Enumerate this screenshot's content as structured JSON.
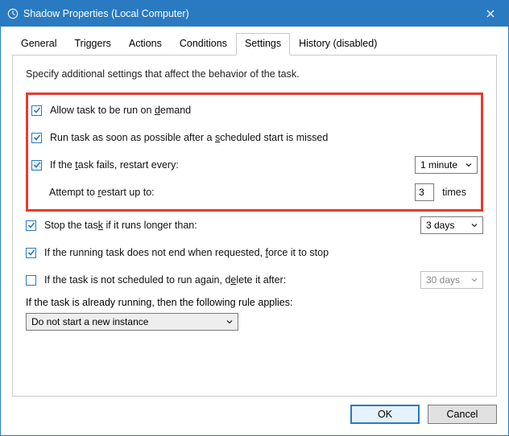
{
  "window": {
    "title": "Shadow Properties (Local Computer)"
  },
  "tabs": {
    "general": "General",
    "triggers": "Triggers",
    "actions": "Actions",
    "conditions": "Conditions",
    "settings": "Settings",
    "history": "History (disabled)"
  },
  "settings": {
    "description": "Specify additional settings that affect the behavior of the task.",
    "allow_on_demand_prefix": "Allow task to be run on ",
    "allow_on_demand_u": "d",
    "allow_on_demand_suffix": "emand",
    "run_asap_prefix": "Run task as soon as possible after a ",
    "run_asap_u": "s",
    "run_asap_suffix": "cheduled start is missed",
    "if_fails_prefix": "If the ",
    "if_fails_u": "t",
    "if_fails_suffix": "ask fails, restart every:",
    "restart_interval": "1 minute",
    "attempt_prefix": "Attempt to ",
    "attempt_u": "r",
    "attempt_suffix": "estart up to:",
    "attempt_count": "3",
    "attempt_times": "times",
    "stop_longer_prefix": "Stop the tas",
    "stop_longer_u": "k",
    "stop_longer_suffix": " if it runs longer than:",
    "stop_longer_value": "3 days",
    "force_stop_prefix": "If the running task does not end when requested, ",
    "force_stop_u": "f",
    "force_stop_suffix": "orce it to stop",
    "delete_after_prefix": "If the task is not scheduled to run again, d",
    "delete_after_u": "e",
    "delete_after_suffix": "lete it after:",
    "delete_after_value": "30 days",
    "rule_text": "If the task is already running, then the following rule applies:",
    "rule_value": "Do not start a new instance"
  },
  "buttons": {
    "ok": "OK",
    "cancel": "Cancel"
  }
}
